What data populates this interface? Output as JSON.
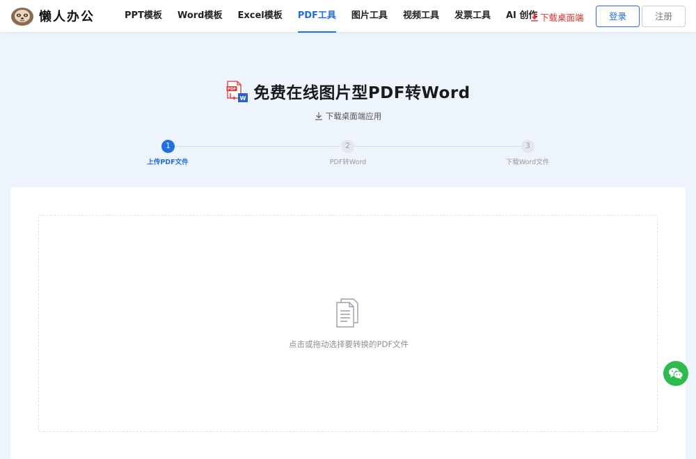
{
  "header": {
    "logo_text": "懒人办公",
    "nav": [
      {
        "label": "PPT模板",
        "active": false
      },
      {
        "label": "Word模板",
        "active": false
      },
      {
        "label": "Excel模板",
        "active": false
      },
      {
        "label": "PDF工具",
        "active": true
      },
      {
        "label": "图片工具",
        "active": false
      },
      {
        "label": "视频工具",
        "active": false
      },
      {
        "label": "发票工具",
        "active": false
      },
      {
        "label": "AI 创作",
        "active": false
      }
    ],
    "download_label": "下载桌面端",
    "login_label": "登录",
    "register_label": "注册"
  },
  "hero": {
    "title": "免费在线图片型PDF转Word",
    "sub_download": "下载桌面端应用"
  },
  "steps": [
    {
      "number": "1",
      "label": "上传PDF文件",
      "active": true
    },
    {
      "number": "2",
      "label": "PDF转Word",
      "active": false
    },
    {
      "number": "3",
      "label": "下载Word文件",
      "active": false
    }
  ],
  "upload": {
    "hint": "点击或拖动选择要转换的PDF文件"
  },
  "colors": {
    "accent": "#1f6fe5",
    "download_red": "#e5322d",
    "wechat_green": "#2dbb4e",
    "page_bg": "#eef4fd"
  },
  "icons": [
    "sloth-logo-icon",
    "download-icon",
    "pdf-to-word-icon",
    "document-icon",
    "wechat-icon"
  ]
}
